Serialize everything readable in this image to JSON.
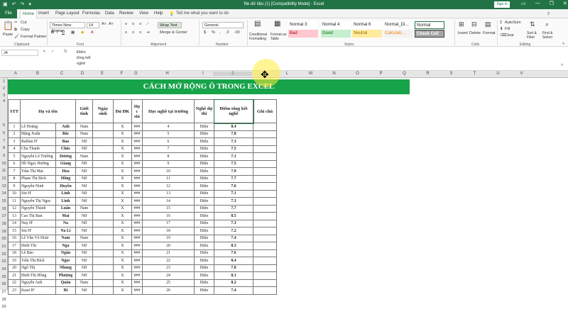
{
  "titlebar": {
    "document_title": "file dữ liệu (1) [Compatibility Mode] - Excel",
    "sign_in": "Sign in",
    "minimize": "—",
    "restore": "❐",
    "close": "✕"
  },
  "tabs": [
    "Home",
    "Insert",
    "Page Layout",
    "Formulas",
    "Data",
    "Review",
    "View",
    "Help"
  ],
  "file_tab": "File",
  "tell_me": "Tell me what you want to do",
  "ribbon": {
    "clipboard": {
      "paste": "Paste",
      "cut": "Cut",
      "copy": "Copy",
      "format_painter": "Format Painter",
      "label": "Clipboard"
    },
    "font": {
      "name": "Times New Roman",
      "size": "14",
      "bold": "B",
      "italic": "I",
      "underline": "U",
      "label": "Font"
    },
    "alignment": {
      "wrap_text": "Wrap Text",
      "merge_center": "Merge & Center",
      "label": "Alignment"
    },
    "number": {
      "format": "General",
      "label": "Number"
    },
    "styles": {
      "conditional": "Conditional Formatting",
      "format_table": "Format as Table",
      "items": [
        {
          "text": "Normal 3",
          "bg": "#ffffff",
          "color": "#222222"
        },
        {
          "text": "Normal 4",
          "bg": "#ffffff",
          "color": "#222222"
        },
        {
          "text": "Normal 6",
          "bg": "#ffffff",
          "color": "#222222"
        },
        {
          "text": "Normal_Di...",
          "bg": "#ffffff",
          "color": "#222222"
        },
        {
          "text": "Normal",
          "bg": "#ffffff",
          "color": "#222222"
        },
        {
          "text": "Bad",
          "bg": "#ffc7ce",
          "color": "#9c0006"
        },
        {
          "text": "Good",
          "bg": "#c6efce",
          "color": "#006100"
        },
        {
          "text": "Neutral",
          "bg": "#ffeb9c",
          "color": "#9c6500"
        },
        {
          "text": "Calculati...",
          "bg": "#f2f2f2",
          "color": "#fa7d00"
        },
        {
          "text": "Check Cell",
          "bg": "#a5a5a5",
          "color": "#ffffff"
        }
      ],
      "label": "Styles"
    },
    "cells": {
      "insert": "Insert",
      "delete": "Delete",
      "format": "Format",
      "label": "Cells"
    },
    "editing": {
      "autosum": "AutoSum",
      "fill": "Fill",
      "clear": "Clear",
      "sort": "Sort & Filter",
      "find": "Find & Select",
      "label": "Editing"
    }
  },
  "formula_bar": {
    "name_box": "J4",
    "fx": "fx",
    "content_lines": [
      "Điểm",
      "tổng kết",
      "nghề"
    ]
  },
  "columns": [
    "A",
    "B",
    "C",
    "D",
    "E",
    "F",
    "G",
    "H",
    "I",
    "J",
    "K",
    "L",
    "M",
    "N",
    "O",
    "P",
    "Q",
    "R",
    "S",
    "T",
    "U",
    "V"
  ],
  "row_numbers": [
    "1",
    "2",
    "3",
    "4",
    "5",
    "6",
    "7",
    "8",
    "9",
    "10",
    "11",
    "12",
    "13",
    "14",
    "15",
    "16",
    "17",
    "18",
    "19",
    "20",
    "21",
    "22",
    "23",
    "24",
    "25",
    "26",
    "27",
    "28",
    "29"
  ],
  "sheet": {
    "title": "CÁCH MỞ RỘNG Ô TRONG EXCEL",
    "headers": [
      "STT",
      "Họ và tên",
      "",
      "Giới tính",
      "Ngày sinh",
      "Đủ ĐK",
      "Họ c sin",
      "Học nghề tại trường",
      "Nghề dự thi",
      "Điểm tổng kết nghề",
      "Ghi chú"
    ],
    "rows": [
      [
        "1",
        "Lê Hoàng",
        "Anh",
        "Nam",
        "",
        "X",
        "###",
        "4",
        "Điện",
        "8.4",
        ""
      ],
      [
        "2",
        "Đặng Xuân",
        "Bắc",
        "Nam",
        "",
        "X",
        "###",
        "5",
        "Điện",
        "7.8",
        ""
      ],
      [
        "3",
        "Rahlan H'",
        "Bao",
        "Nữ",
        "",
        "X",
        "###",
        "6",
        "Điện",
        "7.3",
        ""
      ],
      [
        "4",
        "Chu Thanh",
        "Chúc",
        "Nữ",
        "",
        "X",
        "###",
        "7",
        "Điện",
        "7.5",
        ""
      ],
      [
        "5",
        "Nguyễn Lê Trường",
        "Dương",
        "Nam",
        "",
        "X",
        "###",
        "8",
        "Điện",
        "7.1",
        ""
      ],
      [
        "6",
        "Hồ Ngọc Hương",
        "Giang",
        "Nữ",
        "",
        "X",
        "###",
        "9",
        "Điện",
        "7.5",
        ""
      ],
      [
        "7",
        "Trần Thị Mai",
        "Hoa",
        "Nữ",
        "",
        "X",
        "###",
        "10",
        "Điện",
        "7.9",
        ""
      ],
      [
        "8",
        "Phạm Thị Bích",
        "Hồng",
        "Nữ",
        "",
        "X",
        "###",
        "11",
        "Điện",
        "7.7",
        ""
      ],
      [
        "9",
        "Nguyễn Ninh",
        "Huyền",
        "Nữ",
        "",
        "X",
        "###",
        "12",
        "Điện",
        "7.6",
        ""
      ],
      [
        "10",
        "Siu H'",
        "Linh",
        "Nữ",
        "",
        "X",
        "###",
        "13",
        "Điện",
        "7.1",
        ""
      ],
      [
        "11",
        "Nguyễn Thị Ngọc",
        "Linh",
        "Nữ",
        "",
        "X",
        "###",
        "14",
        "Điện",
        "7.3",
        ""
      ],
      [
        "12",
        "Nguyễn Thành",
        "Luân",
        "Nam",
        "",
        "X",
        "###",
        "15",
        "Điện",
        "7.7",
        ""
      ],
      [
        "13",
        "Cao Thị Ban",
        "Mai",
        "Nữ",
        "",
        "X",
        "###",
        "16",
        "Điện",
        "8.5",
        ""
      ],
      [
        "14",
        "Nay H'",
        "Na",
        "Nữ",
        "",
        "X",
        "###",
        "17",
        "Điện",
        "7.3",
        ""
      ],
      [
        "15",
        "Siu H'",
        "Na Li",
        "Nữ",
        "",
        "X",
        "###",
        "18",
        "Điện",
        "7.2",
        ""
      ],
      [
        "16",
        "Lê Văn Võ Hoài",
        "Nam",
        "Nam",
        "",
        "X",
        "###",
        "19",
        "Điện",
        "7.4",
        ""
      ],
      [
        "17",
        "Đinh Thị",
        "Nga",
        "Nữ",
        "",
        "X",
        "###",
        "20",
        "Điện",
        "8.3",
        ""
      ],
      [
        "18",
        "Lê Bảo",
        "Ngân",
        "Nữ",
        "",
        "X",
        "###",
        "21",
        "Điện",
        "7.6",
        ""
      ],
      [
        "19",
        "Trần Thị Bích",
        "Ngọc",
        "Nữ",
        "",
        "X",
        "###",
        "22",
        "Điện",
        "8.4",
        ""
      ],
      [
        "20",
        "Ngô Thị",
        "Nhung",
        "Nữ",
        "",
        "X",
        "###",
        "23",
        "Điện",
        "7.8",
        ""
      ],
      [
        "21",
        "Đinh Thị Hồng",
        "Phượng",
        "Nữ",
        "",
        "X",
        "###",
        "24",
        "Điện",
        "8.1",
        ""
      ],
      [
        "22",
        "Nguyễn Anh",
        "Quân",
        "Nam",
        "",
        "X",
        "###",
        "25",
        "Điện",
        "8.2",
        ""
      ],
      [
        "23",
        "Kasơ H'",
        "Ri",
        "Nữ",
        "",
        "X",
        "###",
        "26",
        "Điện",
        "7.4",
        ""
      ]
    ]
  },
  "colors": {
    "excel_green": "#217346",
    "banner_green": "#17a34a",
    "pointer_highlight": "#ffec3c"
  }
}
